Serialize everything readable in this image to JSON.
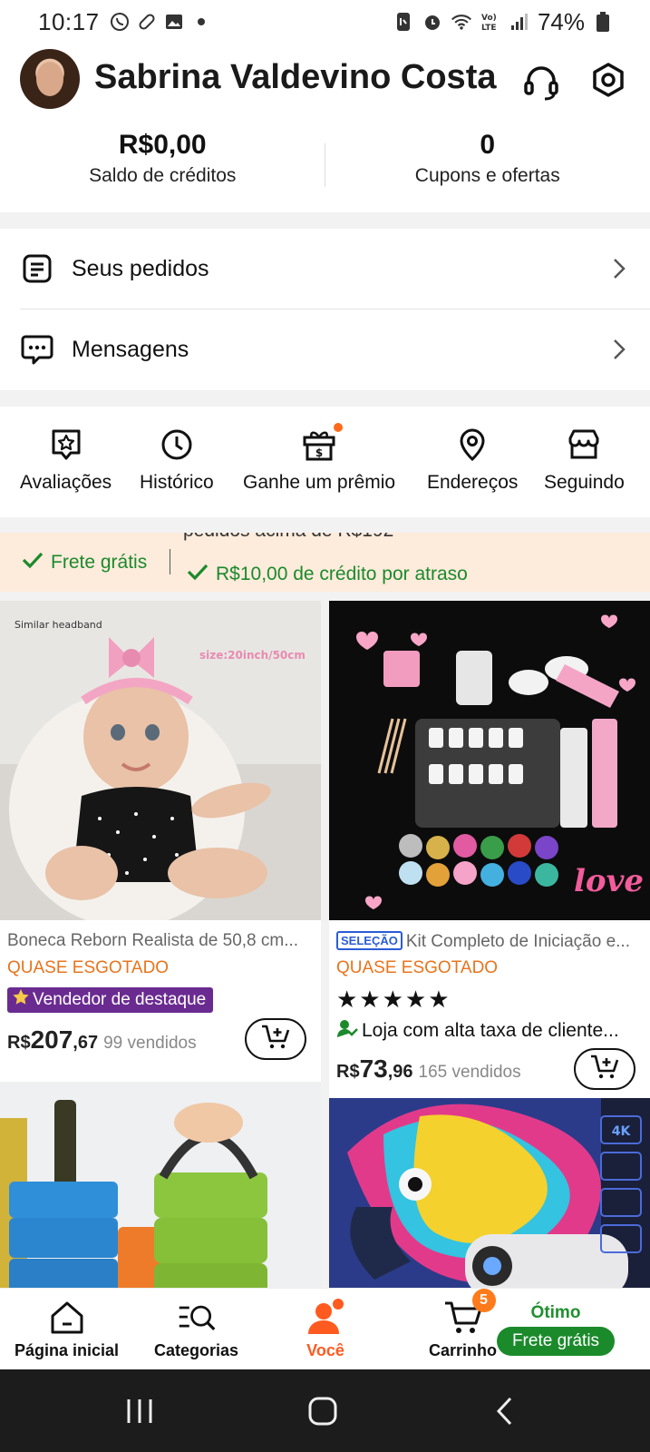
{
  "status_bar": {
    "time": "10:17",
    "battery": "74%",
    "left_icons": [
      "whatsapp-icon",
      "pill-icon",
      "gallery-icon",
      "dot-icon"
    ],
    "right_icons": [
      "nfc-icon",
      "alarm-icon",
      "wifi-icon",
      "volte-icon",
      "signal-icon",
      "battery-icon"
    ]
  },
  "header": {
    "user_name": "Sabrina Valdevino Costa",
    "support_icon": "headset-icon",
    "settings_icon": "settings-icon"
  },
  "stats": [
    {
      "value": "R$0,00",
      "label": "Saldo de créditos"
    },
    {
      "value": "0",
      "label": "Cupons e ofertas"
    }
  ],
  "menu": [
    {
      "label": "Seus pedidos",
      "icon": "orders-icon"
    },
    {
      "label": "Mensagens",
      "icon": "messages-icon"
    }
  ],
  "shortcuts": [
    {
      "label": "Avaliações",
      "icon": "review-star-icon"
    },
    {
      "label": "Histórico",
      "icon": "clock-icon"
    },
    {
      "label": "Ganhe um prêmio",
      "icon": "gift-icon",
      "notification_dot": true
    },
    {
      "label": "Endereços",
      "icon": "location-icon"
    },
    {
      "label": "Seguindo",
      "icon": "store-icon"
    }
  ],
  "banner": {
    "cut_text": "pedidos acima de R$192",
    "item1": "Frete grátis",
    "item2": "R$10,00 de crédito por atraso"
  },
  "products": [
    {
      "title": "Boneca Reborn Realista de 50,8 cm...",
      "stock": "QUASE ESGOTADO",
      "badge": "Vendedor de destaque",
      "currency": "R$",
      "price_int": "207",
      "price_cents": ",67",
      "sold": "99 vendidos",
      "image_text_1": "Similar headband",
      "image_text_2": "size:20inch/50cm"
    },
    {
      "selection_badge": "SELEÇÃO",
      "title": "Kit Completo de Iniciação e...",
      "stock": "QUASE ESGOTADO",
      "rating_stars": 5,
      "stars_text": "★★★★★",
      "store_text": "Loja com alta taxa de cliente...",
      "currency": "R$",
      "price_int": "73",
      "price_cents": ",96",
      "sold": "165 vendidos",
      "image_text_1": "love"
    },
    {
      "image": "lunch-box-image"
    },
    {
      "image": "projector-parrot-image",
      "image_text_1": "4K"
    }
  ],
  "bottom_nav": [
    {
      "label": "Página inicial",
      "icon": "home-icon"
    },
    {
      "label": "Categorias",
      "icon": "categories-search-icon"
    },
    {
      "label": "Você",
      "icon": "user-icon",
      "active": true
    },
    {
      "label": "Carrinho",
      "icon": "cart-icon",
      "badge": "5"
    }
  ],
  "shipping_promo": {
    "title": "Ótimo",
    "pill": "Frete grátis"
  },
  "colors": {
    "accent": "#ff5a1f",
    "green": "#1b8a2b",
    "stock_orange": "#e8741c",
    "badge_purple": "#6a2b91",
    "selection_blue": "#2a5bd7",
    "banner_bg": "#fdebdc"
  }
}
